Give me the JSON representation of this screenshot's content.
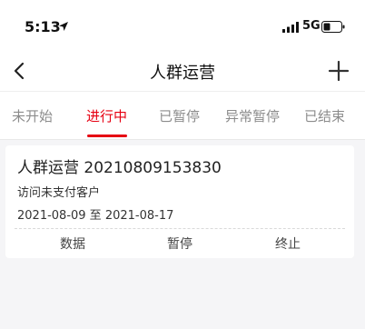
{
  "status_bar": {
    "time": "5:13",
    "network": "5G",
    "icons": [
      "location-arrow-icon",
      "signal-bars-icon",
      "battery-icon"
    ]
  },
  "nav": {
    "title": "人群运营",
    "back_icon": "chevron-left-icon",
    "add_icon": "plus-icon"
  },
  "tabs": [
    {
      "label": "未开始"
    },
    {
      "label": "进行中"
    },
    {
      "label": "已暂停"
    },
    {
      "label": "异常暂停"
    },
    {
      "label": "已结束"
    }
  ],
  "active_tab": "进行中",
  "accent_color": "#e60012",
  "card": {
    "title": "人群运营 20210809153830",
    "subtitle": "访问未支付客户",
    "date_range": "2021-08-09 至 2021-08-17",
    "actions": [
      {
        "label": "数据"
      },
      {
        "label": "暂停"
      },
      {
        "label": "终止"
      }
    ]
  }
}
